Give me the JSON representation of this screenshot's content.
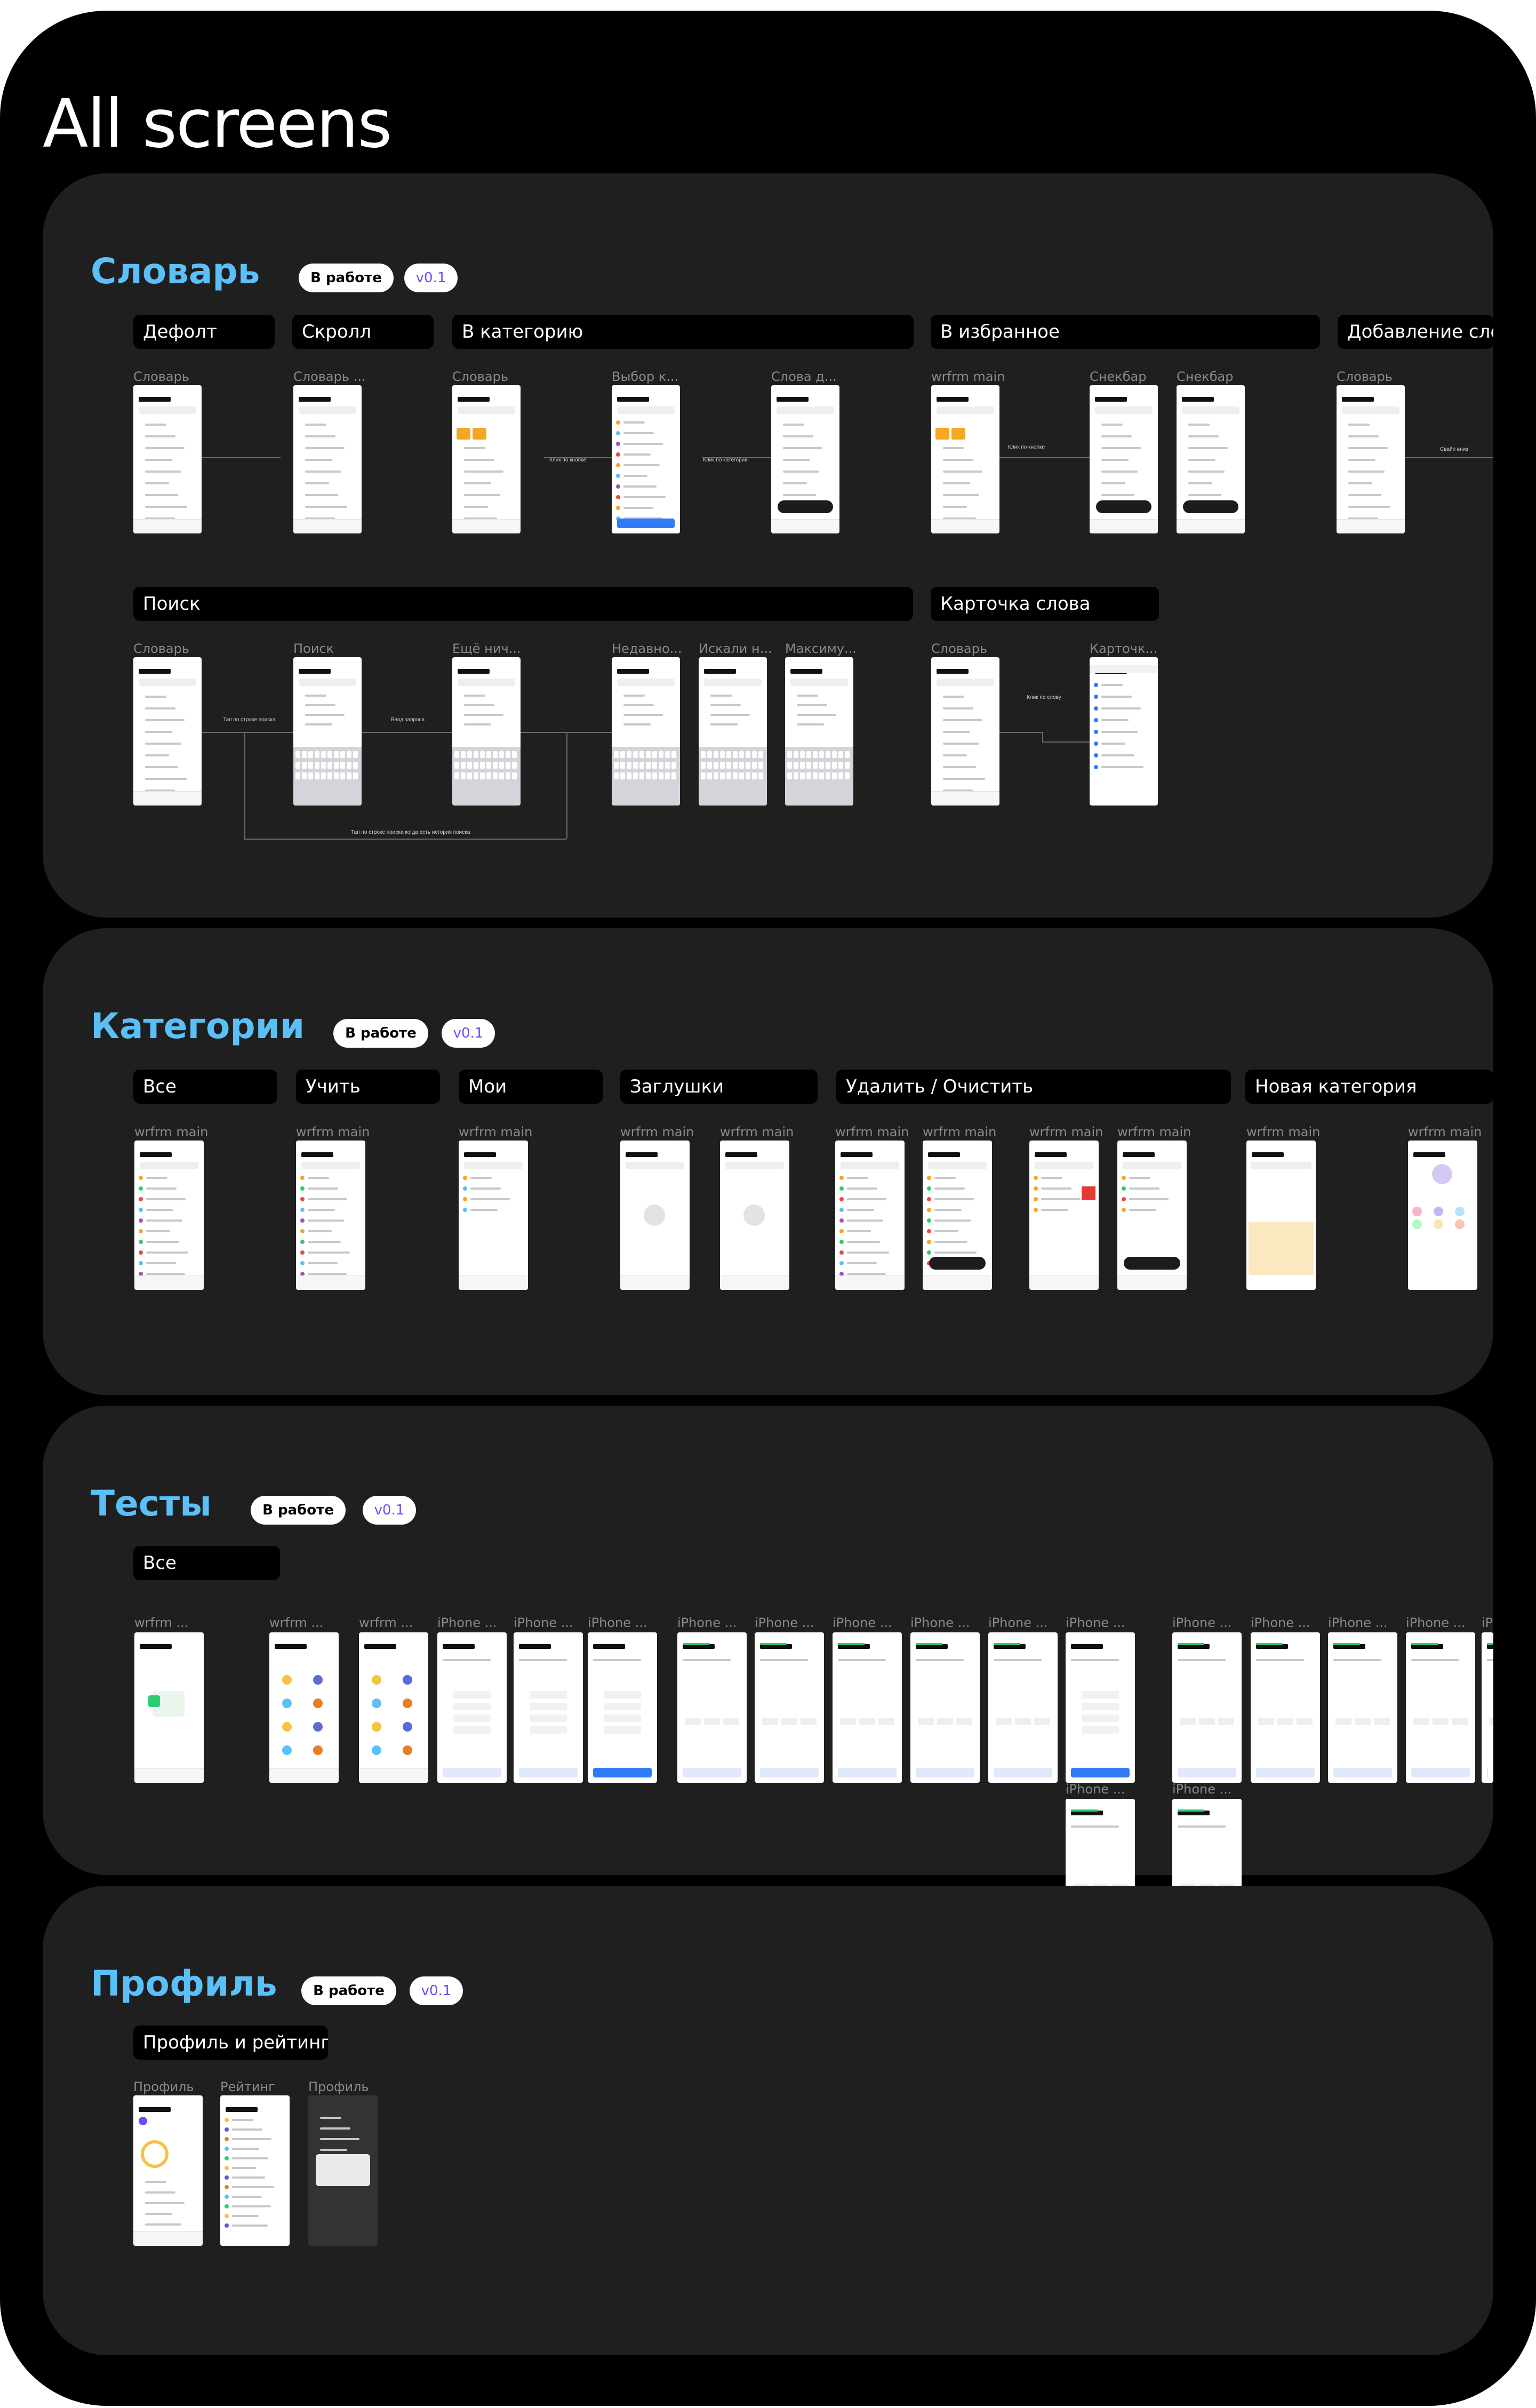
{
  "page_title": "All screens",
  "sections": [
    {
      "id": "slovar",
      "title": "Словарь",
      "status": "В работе",
      "version": "v0.1",
      "tabs": [
        "Дефолт",
        "Скролл",
        "В категорию",
        "В избранное",
        "Добавление слов",
        "Поиск",
        "Карточка слова"
      ],
      "captions": [
        "Словарь",
        "Словарь ...",
        "Словарь",
        "Выбор к...",
        "Слова д...",
        "wrfrm main",
        "Снекбар",
        "Снекбар",
        "Словарь",
        "Словарь",
        "Поиск",
        "Ещё нич...",
        "Недавно...",
        "Искали н...",
        "Максиму...",
        "Словарь",
        "Карточк..."
      ],
      "flow_labels": [
        "Клик по кнопке",
        "Клик по категории",
        "Клик по кнопке",
        "Свайп вниз",
        "Тап по строке поиска",
        "Ввод запроса",
        "Тап по строке поиска когда есть история поиска",
        "Клик по слову"
      ]
    },
    {
      "id": "categories",
      "title": "Категории",
      "status": "В работе",
      "version": "v0.1",
      "tabs": [
        "Все",
        "Учить",
        "Мои",
        "Заглушки",
        "Удалить / Очистить",
        "Новая категория"
      ],
      "captions": [
        "wrfrm main",
        "wrfrm main",
        "wrfrm main",
        "wrfrm main",
        "wrfrm main",
        "wrfrm main",
        "wrfrm main",
        "wrfrm main",
        "wrfrm main",
        "wrfrm main",
        "wrfrm main"
      ]
    },
    {
      "id": "tests",
      "title": "Тесты",
      "status": "В работе",
      "version": "v0.1",
      "tabs": [
        "Все"
      ],
      "captions": [
        "wrfrm ...",
        "wrfrm ...",
        "wrfrm ...",
        "iPhone ...",
        "iPhone ...",
        "iPhone ...",
        "iPhone ...",
        "iPhone ...",
        "iPhone ...",
        "iPhone ...",
        "iPhone ...",
        "iPhone ...",
        "iPhone ...",
        "iPhone ...",
        "iPhone ...",
        "iPhone ...",
        "iP",
        "iPhone ...",
        "iPhone ..."
      ]
    },
    {
      "id": "profile",
      "title": "Профиль",
      "status": "В работе",
      "version": "v0.1",
      "tabs": [
        "Профиль и рейтинги"
      ],
      "captions": [
        "Профиль",
        "Рейтинг",
        "Профиль"
      ]
    }
  ],
  "colors": {
    "section_title": "#5bc0f8",
    "version_text": "#6d4cf5",
    "section_bg": "#1f1f1f",
    "outer_bg": "#000000"
  }
}
